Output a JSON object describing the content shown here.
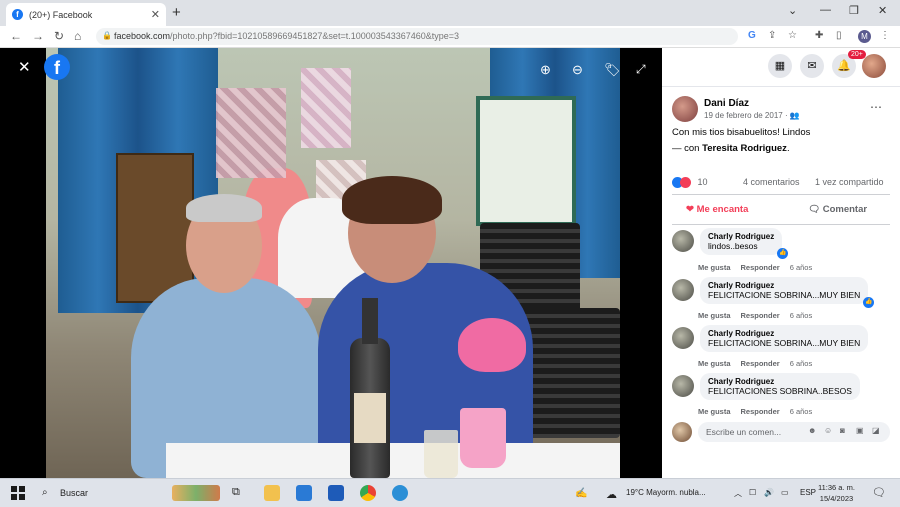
{
  "browser": {
    "tab_title": "(20+) Facebook",
    "url_host": "facebook.com",
    "url_path": "/photo.php?fbid=10210589669451827&set=t.100003543367460&type=3",
    "profile_initial": "M"
  },
  "viewer": {
    "logo": "f"
  },
  "header": {
    "notifications_badge": "20+"
  },
  "post": {
    "author": "Dani Díaz",
    "date": "19 de febrero de 2017 · ",
    "caption": "Con mis tios bisabuelitos! Lindos",
    "with_prefix": "— con ",
    "tagged": "Teresita Rodriguez",
    "reaction_count": "10",
    "comments_count": "4 comentarios",
    "shares": "1 vez compartido",
    "love_label": "Me encanta",
    "comment_label": "Comentar"
  },
  "comments": [
    {
      "name": "Charly Rodriguez",
      "text": "lindos..besos",
      "like": "Me gusta",
      "reply": "Responder",
      "age": "6 años"
    },
    {
      "name": "Charly Rodriguez",
      "text": "FELICITACIONE SOBRINA...MUY BIEN",
      "like": "Me gusta",
      "reply": "Responder",
      "age": "6 años"
    },
    {
      "name": "Charly Rodriguez",
      "text": "FELICITACIONE SOBRINA...MUY BIEN",
      "like": "Me gusta",
      "reply": "Responder",
      "age": "6 años"
    },
    {
      "name": "Charly Rodriguez",
      "text": "FELICITACIONES SOBRINA..BESOS",
      "like": "Me gusta",
      "reply": "Responder",
      "age": "6 años"
    }
  ],
  "write_comment": {
    "placeholder": "Escribe un comen..."
  },
  "taskbar": {
    "search_label": "Buscar",
    "weather": "19°C  Mayorm. nubla...",
    "lang": "ESP",
    "time": "11:36 a. m.",
    "date": "15/4/2023"
  }
}
